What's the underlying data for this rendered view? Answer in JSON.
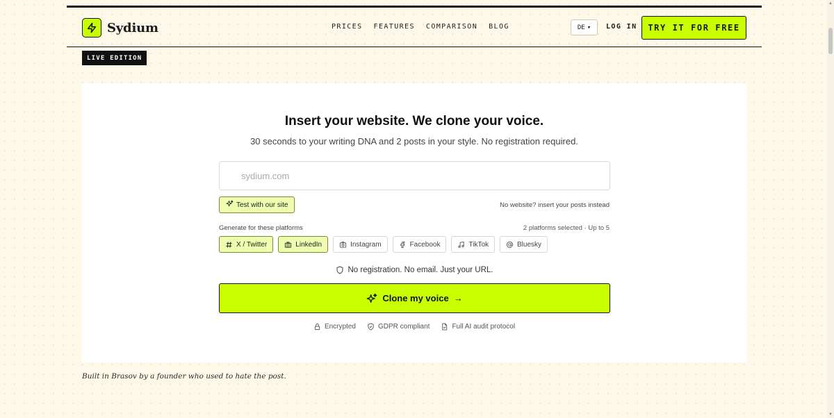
{
  "brand": {
    "name": "Sydium",
    "accent": "#c9ff00"
  },
  "nav": {
    "items": [
      "PRICES",
      "FEATURES",
      "COMPARISON",
      "BLOG"
    ]
  },
  "header": {
    "lang": "DE",
    "login": "LOG IN",
    "cta": "TRY IT FOR FREE"
  },
  "edition_badge": "LIVE EDITION",
  "hero": {
    "title": "Insert your website. We clone your voice.",
    "subtitle": "30 seconds to your writing DNA and 2 posts in your style. No registration required."
  },
  "form": {
    "url_placeholder": "sydium.com",
    "test_button": "Test with our site",
    "alt_link": "No website? insert your posts instead",
    "platforms_label": "Generate for these platforms",
    "platforms_count": "2 platforms selected · Up to 5",
    "platforms": [
      {
        "label": "X / Twitter",
        "icon": "hash-icon",
        "selected": true
      },
      {
        "label": "LinkedIn",
        "icon": "briefcase-icon",
        "selected": true
      },
      {
        "label": "Instagram",
        "icon": "camera-icon",
        "selected": false
      },
      {
        "label": "Facebook",
        "icon": "facebook-icon",
        "selected": false
      },
      {
        "label": "TikTok",
        "icon": "music-note-icon",
        "selected": false
      },
      {
        "label": "Bluesky",
        "icon": "at-icon",
        "selected": false
      }
    ],
    "no_registration": "No registration. No email. Just your URL.",
    "submit": "Clone my voice",
    "trust": [
      {
        "label": "Encrypted",
        "icon": "lock-icon"
      },
      {
        "label": "GDPR compliant",
        "icon": "shield-check-icon"
      },
      {
        "label": "Full AI audit protocol",
        "icon": "document-check-icon"
      }
    ]
  },
  "footer_note": "Built in Brasov by a founder who used to hate the post."
}
